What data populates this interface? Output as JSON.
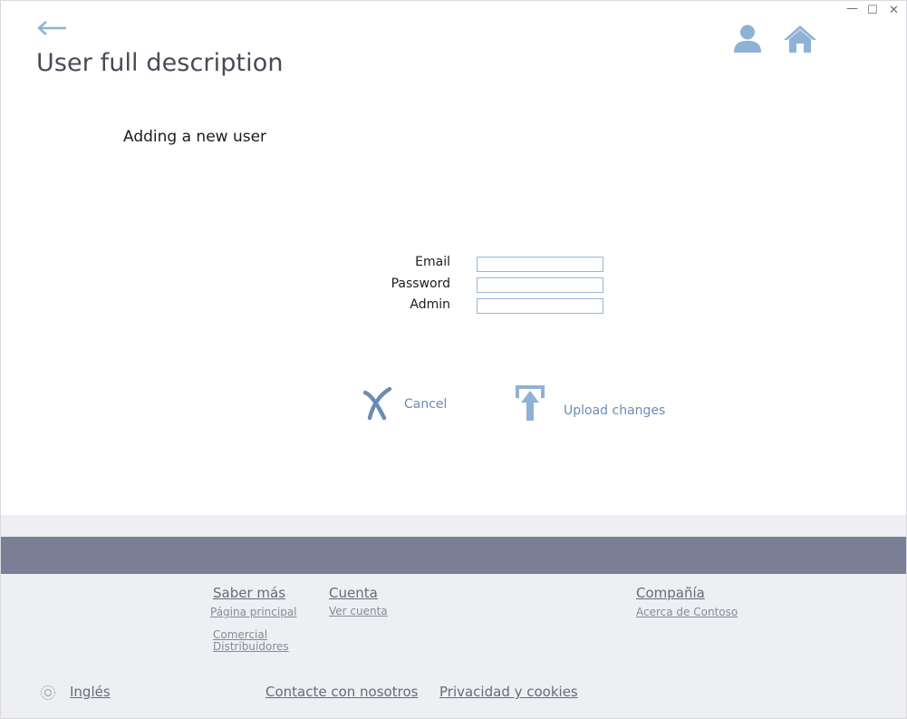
{
  "window_controls": {
    "minimize": "—",
    "maximize": "☐",
    "close": "✕"
  },
  "header": {
    "title": "User full description",
    "icons": [
      "back-arrow-icon",
      "user-icon",
      "home-icon"
    ]
  },
  "main": {
    "subtitle": "Adding a new user",
    "form": {
      "fields": [
        {
          "label": "Email",
          "value": "",
          "placeholder": ""
        },
        {
          "label": "Password",
          "value": "",
          "placeholder": ""
        },
        {
          "label": "Admin",
          "value": "",
          "placeholder": ""
        }
      ]
    },
    "actions": {
      "cancel_label": "Cancel",
      "upload_label": "Upload changes"
    }
  },
  "footer": {
    "col1": {
      "heading": "Saber más",
      "links": [
        "Página principal",
        "Comercial",
        "Distribuidores"
      ]
    },
    "col2": {
      "heading": "Cuenta",
      "links": [
        "Ver cuenta"
      ]
    },
    "col3": {
      "heading": "Compañía",
      "links": [
        "Acerca de Contoso"
      ]
    },
    "language": "Inglés",
    "contact": "Contacte con nosotros",
    "privacy": "Privacidad y cookies"
  },
  "colors": {
    "accent": "#8fb1d6",
    "footer_band": "#7b7f96",
    "footer_bg": "#eeeff3",
    "title_text": "#4a4a56"
  }
}
